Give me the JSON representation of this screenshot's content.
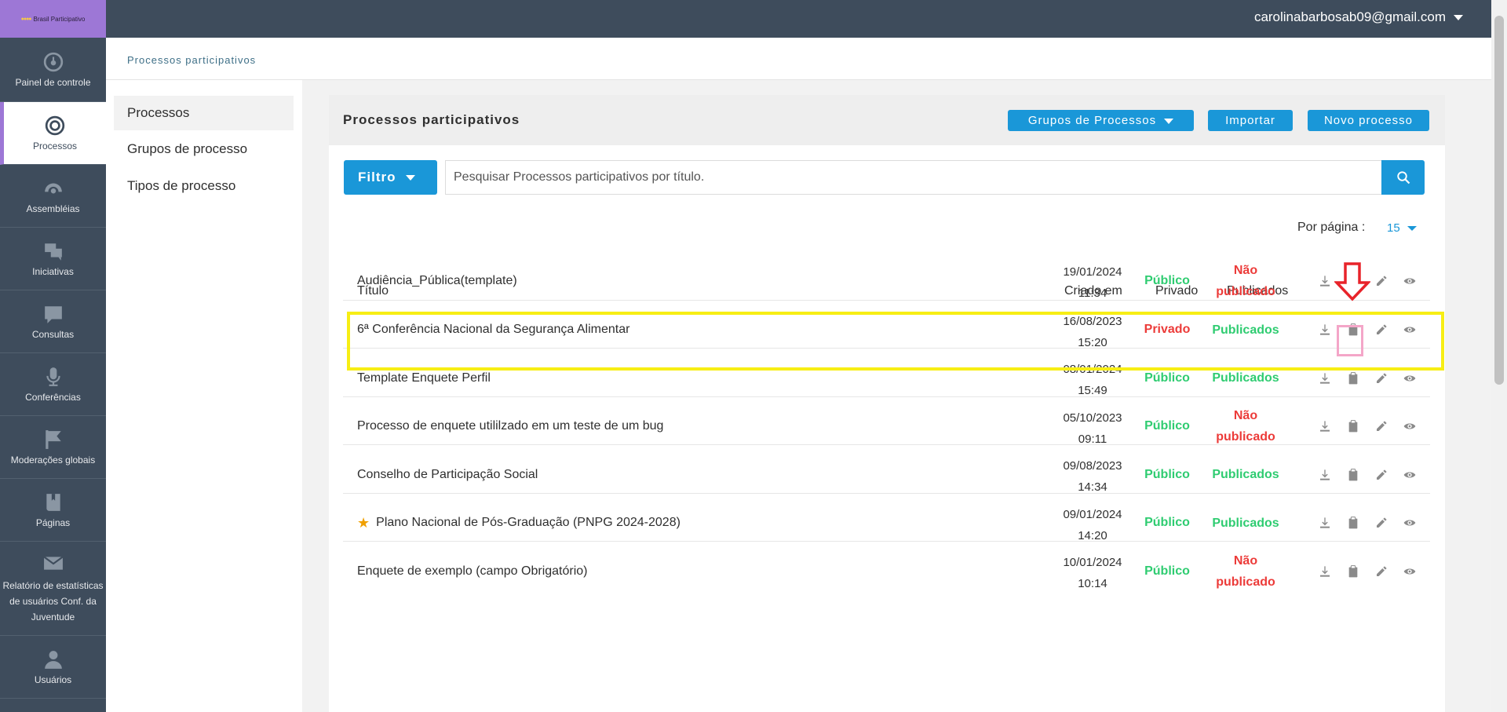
{
  "brand": {
    "logo_text": "Brasil Participativo",
    "color": "#9d77d6"
  },
  "user": {
    "email": "carolinabarbosab09@gmail.com"
  },
  "sidebar": {
    "items": [
      {
        "label": "Painel de controle",
        "icon": "dashboard-icon"
      },
      {
        "label": "Processos",
        "icon": "target-icon",
        "active": true
      },
      {
        "label": "Assembléias",
        "icon": "assembly-icon"
      },
      {
        "label": "Iniciativas",
        "icon": "chat-bubbles-icon"
      },
      {
        "label": "Consultas",
        "icon": "comment-icon"
      },
      {
        "label": "Conferências",
        "icon": "microphone-icon"
      },
      {
        "label": "Moderações globais",
        "icon": "flag-icon"
      },
      {
        "label": "Páginas",
        "icon": "book-icon"
      },
      {
        "label": "Relatório de estatísticas de usuários Conf. da Juventude",
        "icon": "envelope-icon"
      },
      {
        "label": "Usuários",
        "icon": "user-icon"
      }
    ]
  },
  "breadcrumb": "Processos participativos",
  "subnav": {
    "items": [
      {
        "label": "Processos",
        "active": true
      },
      {
        "label": "Grupos de processo"
      },
      {
        "label": "Tipos de processo"
      }
    ]
  },
  "card": {
    "title": "Processos participativos",
    "groups_button": "Grupos de Processos",
    "import_button": "Importar",
    "new_button": "Novo processo"
  },
  "filter": {
    "label": "Filtro",
    "search_placeholder": "Pesquisar Processos participativos por título."
  },
  "pagination": {
    "per_page_label": "Por página :",
    "per_page_value": "15"
  },
  "table": {
    "headers": {
      "title": "Título",
      "created": "Criado em",
      "private": "Privado",
      "published": "Publicados"
    },
    "rows": [
      {
        "title": "Audiência_Pública(template)",
        "date": "19/01/2024",
        "time": "11:34",
        "privacy": "Público",
        "publish_line1": "Não",
        "publish_line2": "publicado",
        "starred": false
      },
      {
        "title": "6ª Conferência Nacional da Segurança Alimentar",
        "date": "16/08/2023",
        "time": "15:20",
        "privacy": "Privado",
        "publish_line1": "Publicados",
        "publish_line2": "",
        "starred": false
      },
      {
        "title": "Template Enquete Perfil",
        "date": "08/01/2024",
        "time": "15:49",
        "privacy": "Público",
        "publish_line1": "Publicados",
        "publish_line2": "",
        "starred": false
      },
      {
        "title": "Processo de enquete utililzado em um teste de um bug",
        "date": "05/10/2023",
        "time": "09:11",
        "privacy": "Público",
        "publish_line1": "Não",
        "publish_line2": "publicado",
        "starred": false
      },
      {
        "title": "Conselho de Participação Social",
        "date": "09/08/2023",
        "time": "14:34",
        "privacy": "Público",
        "publish_line1": "Publicados",
        "publish_line2": "",
        "starred": false
      },
      {
        "title": "Plano Nacional de Pós-Graduação (PNPG 2024-2028)",
        "date": "09/01/2024",
        "time": "14:20",
        "privacy": "Público",
        "publish_line1": "Publicados",
        "publish_line2": "",
        "starred": true
      },
      {
        "title": "Enquete de exemplo (campo Obrigatório)",
        "date": "10/01/2024",
        "time": "10:14",
        "privacy": "Público",
        "publish_line1": "Não",
        "publish_line2": "publicado",
        "starred": false
      }
    ],
    "row_actions": [
      "download-icon",
      "clipboard-icon",
      "pencil-icon",
      "eye-icon"
    ]
  },
  "colors": {
    "accent": "#1a97d8",
    "topbar": "#3e4c5c",
    "public": "#2fcc71",
    "private": "#ec3b39",
    "highlight": "#f7ee14",
    "annotation_arrow": "#e8232a"
  }
}
